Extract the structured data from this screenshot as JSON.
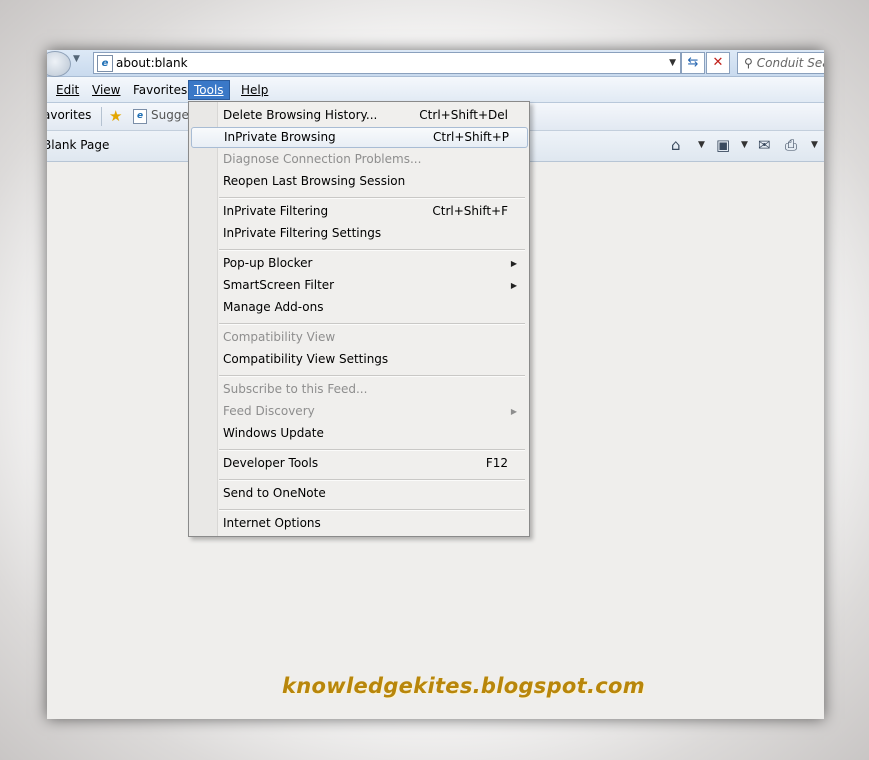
{
  "address_bar": {
    "url": "about:blank",
    "search_placeholder": "Conduit Sea"
  },
  "menubar": {
    "items": [
      {
        "label": "Edit"
      },
      {
        "label": "View"
      },
      {
        "label": "Favorites"
      },
      {
        "label": "Tools"
      },
      {
        "label": "Help"
      }
    ],
    "active": "Tools"
  },
  "favorites_bar": {
    "label": "avorites",
    "suggested": "Sugges"
  },
  "tab": {
    "title": "Blank Page"
  },
  "tools_menu": {
    "items": [
      {
        "label": "Delete Browsing History...",
        "shortcut": "Ctrl+Shift+Del",
        "disabled": false
      },
      {
        "label": "InPrivate Browsing",
        "shortcut": "Ctrl+Shift+P",
        "highlighted": true
      },
      {
        "label": "Diagnose Connection Problems...",
        "disabled": true
      },
      {
        "label": "Reopen Last Browsing Session"
      },
      {
        "label": "InPrivate Filtering",
        "shortcut": "Ctrl+Shift+F"
      },
      {
        "label": "InPrivate Filtering Settings"
      },
      {
        "label": "Pop-up Blocker",
        "submenu": true
      },
      {
        "label": "SmartScreen Filter",
        "submenu": true
      },
      {
        "label": "Manage Add-ons"
      },
      {
        "label": "Compatibility View",
        "disabled": true
      },
      {
        "label": "Compatibility View Settings"
      },
      {
        "label": "Subscribe to this Feed...",
        "disabled": true
      },
      {
        "label": "Feed Discovery",
        "disabled": true,
        "submenu": true
      },
      {
        "label": "Windows Update"
      },
      {
        "label": "Developer Tools",
        "shortcut": "F12"
      },
      {
        "label": "Send to OneNote"
      },
      {
        "label": "Internet Options"
      }
    ]
  },
  "watermark": "knowledgekites.blogspot.com",
  "colors": {
    "menu_active": "#3a78c7",
    "watermark": "#b8860b",
    "stop_icon": "#c0201a"
  }
}
